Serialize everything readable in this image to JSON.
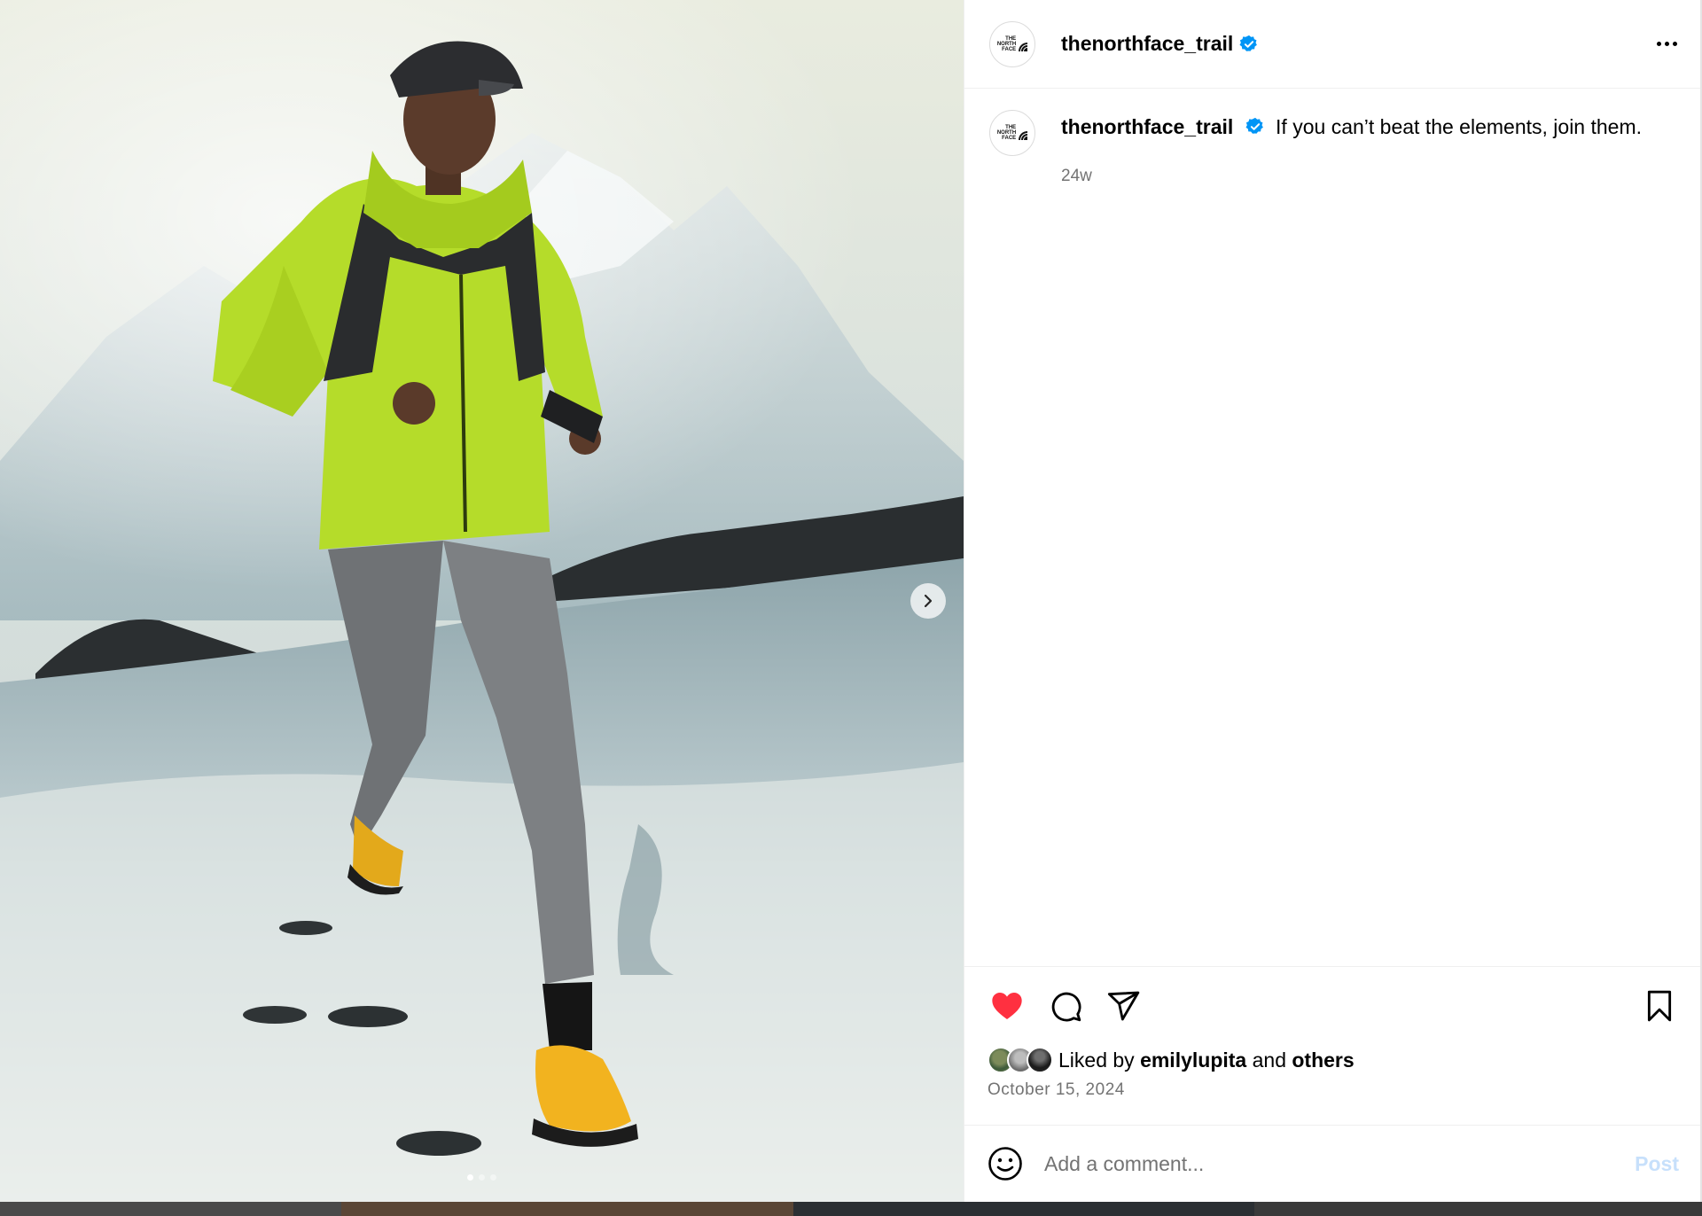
{
  "post": {
    "username": "thenorthface_trail",
    "avatar_logo_lines": [
      "THE",
      "NORTH",
      "FACE"
    ],
    "caption": "If you can’t beat the elements, join them.",
    "time_ago": "24w",
    "liked_by_prefix": "Liked by",
    "liked_by_user": "emilylupita",
    "liked_by_and": "and",
    "liked_by_others": "others",
    "date": "October 15, 2024",
    "liked": true
  },
  "comment": {
    "placeholder": "Add a comment...",
    "post_label": "Post"
  },
  "carousel": {
    "total": 3,
    "active_index": 0
  },
  "colors": {
    "verified": "#0095f6",
    "like_red": "#ff3040",
    "post_disabled": "#c7e0fb",
    "jacket": "#b5dc2a",
    "pants": "#7b7d80",
    "shoes": "#f2b31f"
  },
  "icons": {
    "like": "heart-icon",
    "comment": "comment-icon",
    "share": "paper-plane-icon",
    "save": "bookmark-icon",
    "more": "more-options-icon",
    "emoji": "smiley-icon",
    "next": "chevron-right-icon"
  }
}
